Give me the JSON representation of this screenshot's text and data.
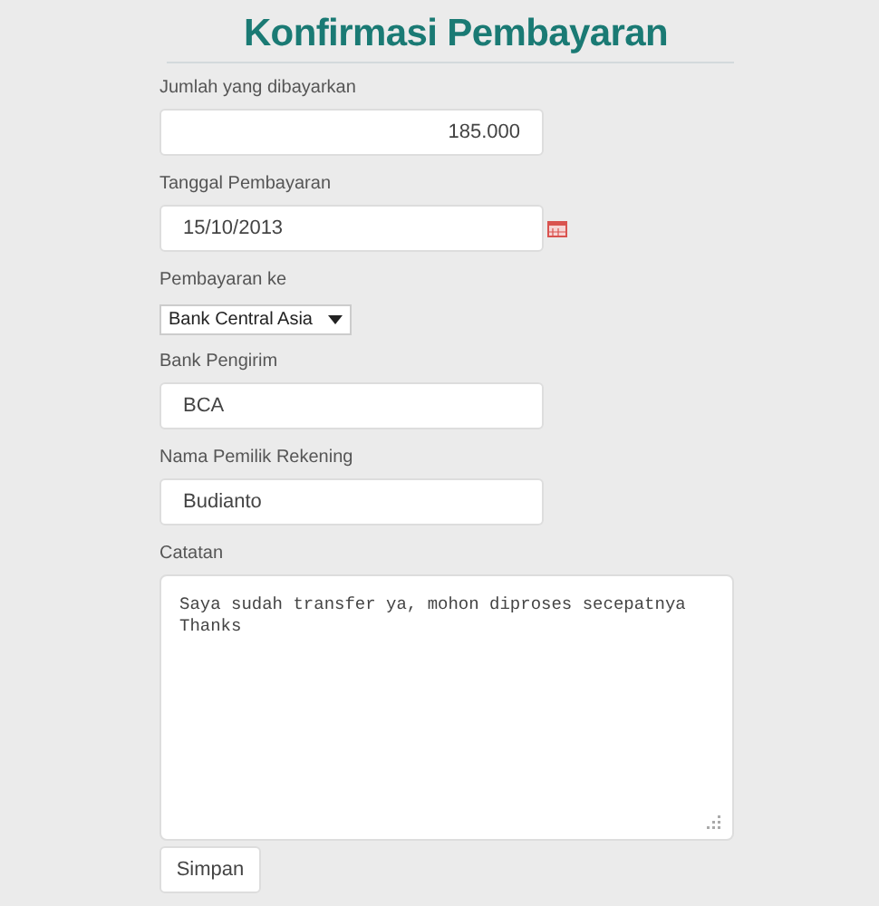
{
  "title": "Konfirmasi Pembayaran",
  "fields": [
    {
      "kind": "number",
      "label": "Jumlah yang dibayarkan",
      "value": "185.000"
    },
    {
      "kind": "date",
      "label": "Tanggal Pembayaran",
      "value": "15/10/2013"
    },
    {
      "kind": "select",
      "label": "Pembayaran ke",
      "value": "Bank Central Asia"
    },
    {
      "kind": "text",
      "label": "Bank Pengirim",
      "value": "BCA"
    },
    {
      "kind": "text",
      "label": "Nama Pemilik Rekening",
      "value": "Budianto"
    },
    {
      "kind": "textarea",
      "label": "Catatan",
      "value": "Saya sudah transfer ya, mohon diproses secepatnya\nThanks"
    }
  ],
  "buttons": [
    "Simpan"
  ]
}
